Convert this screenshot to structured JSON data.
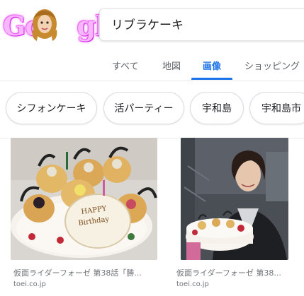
{
  "search": {
    "query": "リブラケーキ"
  },
  "tabs": [
    {
      "label": "すべて"
    },
    {
      "label": "地図"
    },
    {
      "label": "画像"
    },
    {
      "label": "ショッピング"
    }
  ],
  "chips": [
    {
      "label": "シフォンケーキ"
    },
    {
      "label": "活パーティー"
    },
    {
      "label": "宇和島"
    },
    {
      "label": "宇和島市"
    }
  ],
  "results": [
    {
      "title": "仮面ライダーフォーゼ 第38話「勝...",
      "source": "toei.co.jp",
      "image_icon": "birthday-cake-photo"
    },
    {
      "title": "仮面ライダーフォーゼ 第38...",
      "source": "toei.co.jp",
      "image_icon": "person-with-cake-photo"
    }
  ],
  "colors": {
    "accent": "#1a73e8",
    "logo_pink": "#f7b6ff"
  }
}
